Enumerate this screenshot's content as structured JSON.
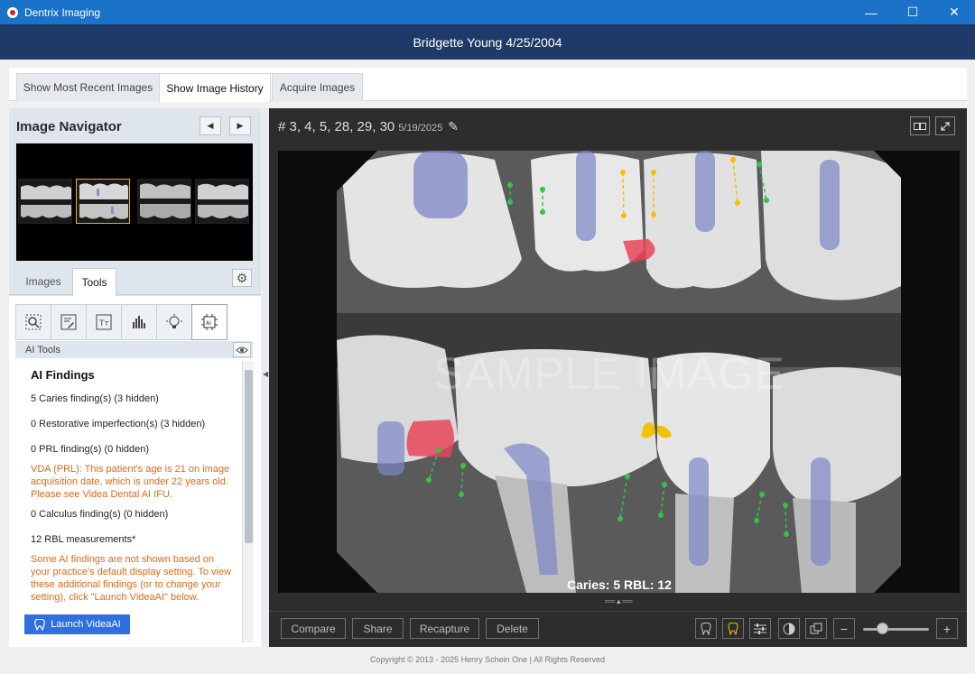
{
  "window": {
    "app_title": "Dentrix Imaging",
    "minimize": "—",
    "maximize": "☐",
    "close": "✕"
  },
  "patient_header": "Bridgette Young 4/25/2004",
  "top_tabs": [
    {
      "label": "Show Most Recent Images",
      "active": false
    },
    {
      "label": "Show Image History",
      "active": true
    },
    {
      "label": "Acquire Images",
      "active": false
    }
  ],
  "navigator": {
    "title": "Image Navigator",
    "prev": "◀",
    "next": "▶",
    "thumbnail_count": 4,
    "selected_thumbnail": 2
  },
  "sub_tabs": [
    {
      "label": "Images",
      "active": false
    },
    {
      "label": "Tools",
      "active": true
    }
  ],
  "tool_icons": [
    "zoom-region-icon",
    "annotate-icon",
    "text-measure-icon",
    "histogram-icon",
    "lightbulb-icon",
    "ai-chip-icon"
  ],
  "ai_tools": {
    "header": "AI Tools",
    "findings_title": "AI Findings",
    "caries": "5 Caries finding(s) (3 hidden)",
    "restorative": "0 Restorative imperfection(s) (3 hidden)",
    "prl": "0 PRL finding(s) (0 hidden)",
    "prl_warning": "VDA (PRL): This patient's age is 21 on image acquisition date, which is under 22 years old. Please see Videa Dental AI IFU.",
    "calculus": "0 Calculus finding(s) (0 hidden)",
    "rbl": "12 RBL measurements*",
    "hidden_note": "Some AI findings are not shown based on your practice's default display setting. To view these additional findings (or to change your setting), click \"Launch VideaAI\" below.",
    "launch_button": "Launch VideaAI"
  },
  "viewer": {
    "title": "# 3, 4, 5, 28, 29, 30",
    "date": "5/19/2025",
    "watermark": "SAMPLE IMAGE",
    "overlay": "Caries: 5 RBL: 12",
    "buttons": {
      "compare": "Compare",
      "share": "Share",
      "recapture": "Recapture",
      "delete": "Delete",
      "zoom_out": "−",
      "zoom_in": "+"
    },
    "colors": {
      "caries": "#e8445a",
      "restorative_pulp": "#7e86c7",
      "rbl_green": "#33c24a",
      "rbl_yellow": "#f2c200"
    }
  },
  "copyright": "Copyright © 2013 - 2025 Henry Schein One | All Rights Reserved"
}
